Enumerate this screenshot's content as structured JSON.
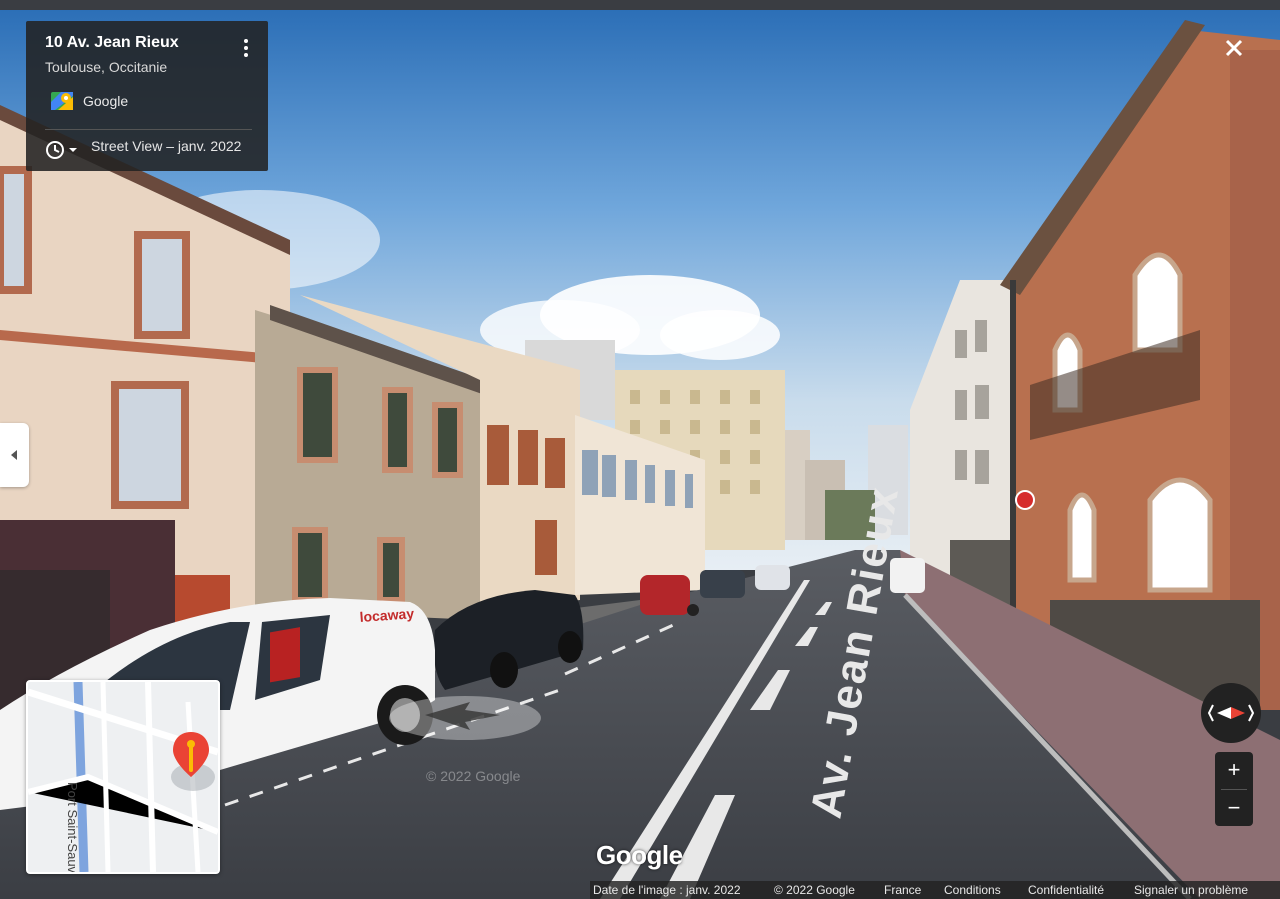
{
  "info_card": {
    "address": "10 Av. Jean Rieux",
    "city": "Toulouse, Occitanie",
    "provider": "Google",
    "street_view_date": "Street View – janv. 2022"
  },
  "minimap": {
    "street_label": "Port Saint-Sauveur"
  },
  "scene": {
    "van_brand": "locaway",
    "road_text": "Av. Jean Rieux",
    "watermark": "© 2022 Google"
  },
  "controls": {
    "zoom_in": "+",
    "zoom_out": "−"
  },
  "footer": {
    "logo": "Google",
    "image_date": "Date de l'image : janv. 2022",
    "copyright": "© 2022 Google",
    "country": "France",
    "terms": "Conditions",
    "privacy": "Confidentialité",
    "report": "Signaler un problème"
  },
  "colors": {
    "sky_top": "#2c6fb7",
    "brick": "#b06a4a",
    "panel_bg": "#222222",
    "pin_red": "#ea4335"
  }
}
